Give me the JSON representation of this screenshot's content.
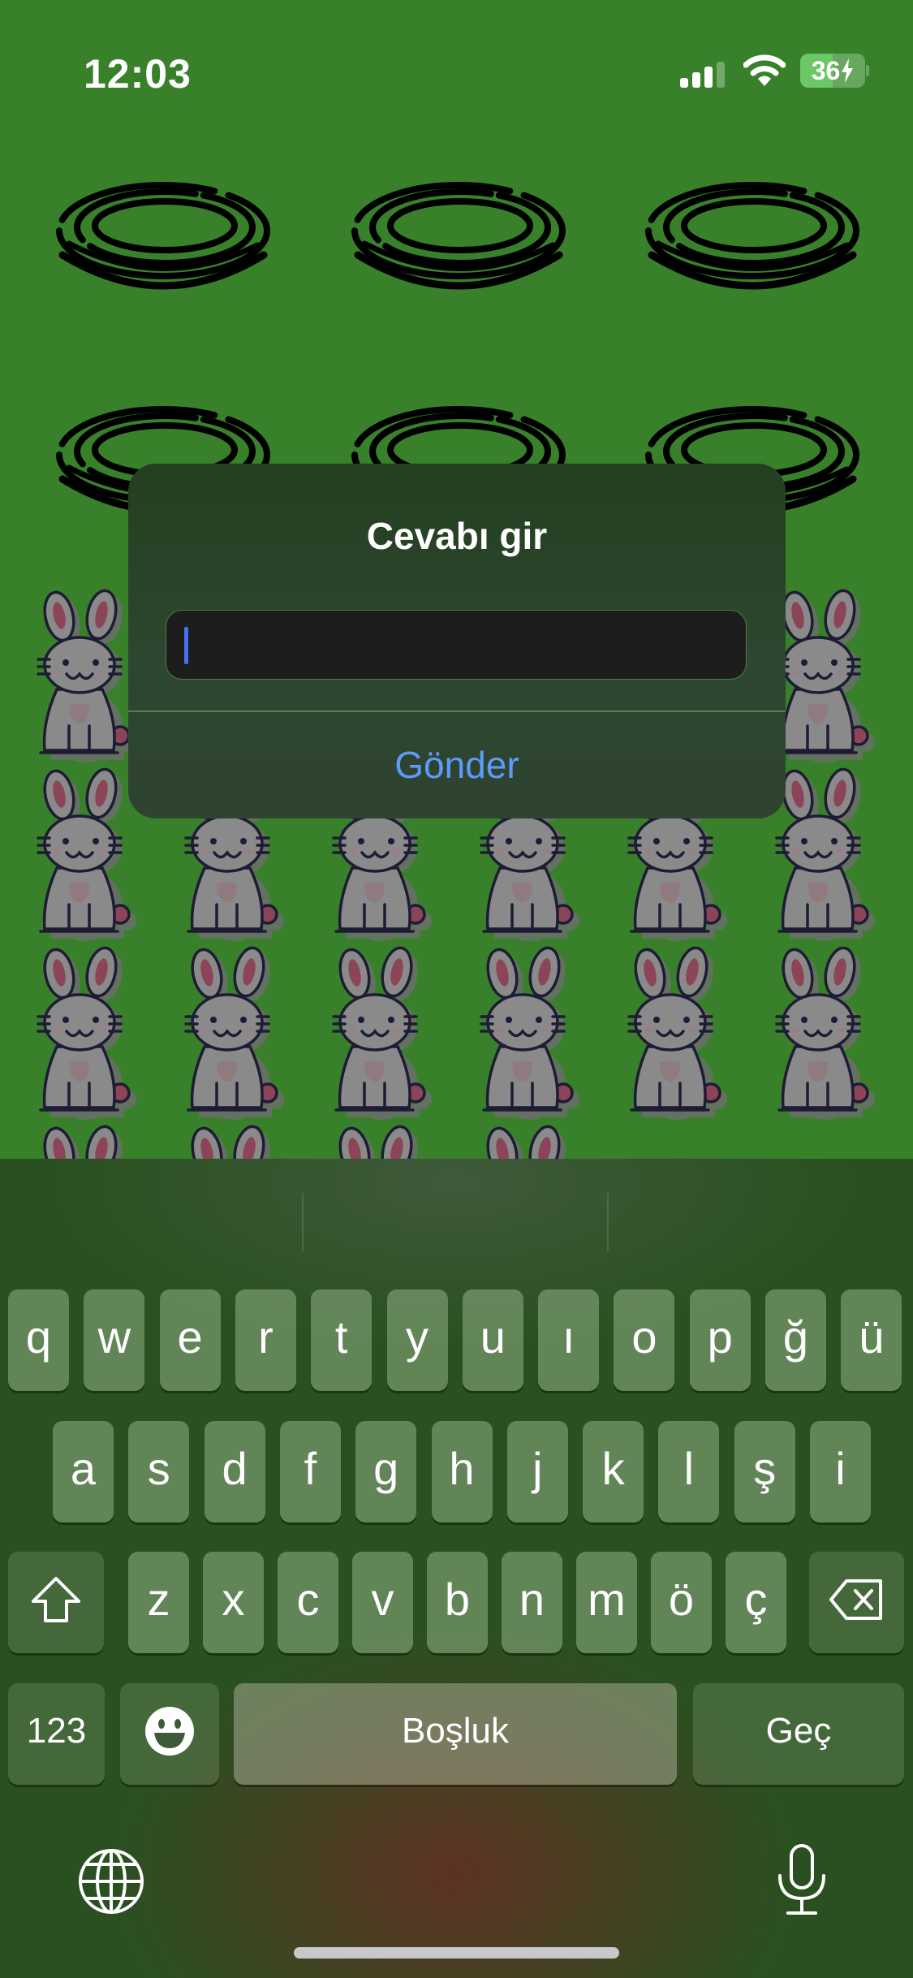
{
  "status_bar": {
    "time": "12:03",
    "battery": "36",
    "icons": [
      "signal-icon",
      "wifi-icon",
      "battery-charging-icon"
    ]
  },
  "background": {
    "ring_icon": "ring-icon",
    "bunny_icon": "bunny-icon"
  },
  "dialog": {
    "title": "Cevabı gir",
    "input_value": "",
    "input_placeholder": "",
    "submit_label": "Gönder"
  },
  "keyboard": {
    "row1": [
      "q",
      "w",
      "e",
      "r",
      "t",
      "y",
      "u",
      "ı",
      "o",
      "p",
      "ğ",
      "ü"
    ],
    "row2": [
      "a",
      "s",
      "d",
      "f",
      "g",
      "h",
      "j",
      "k",
      "l",
      "ş",
      "i"
    ],
    "row3": [
      "z",
      "x",
      "c",
      "v",
      "b",
      "n",
      "m",
      "ö",
      "ç"
    ],
    "numbers_label": "123",
    "space_label": "Boşluk",
    "return_label": "Geç"
  },
  "colors": {
    "background": "#38812a",
    "accent": "#5c9cf7",
    "caret": "#4a6ff0"
  }
}
